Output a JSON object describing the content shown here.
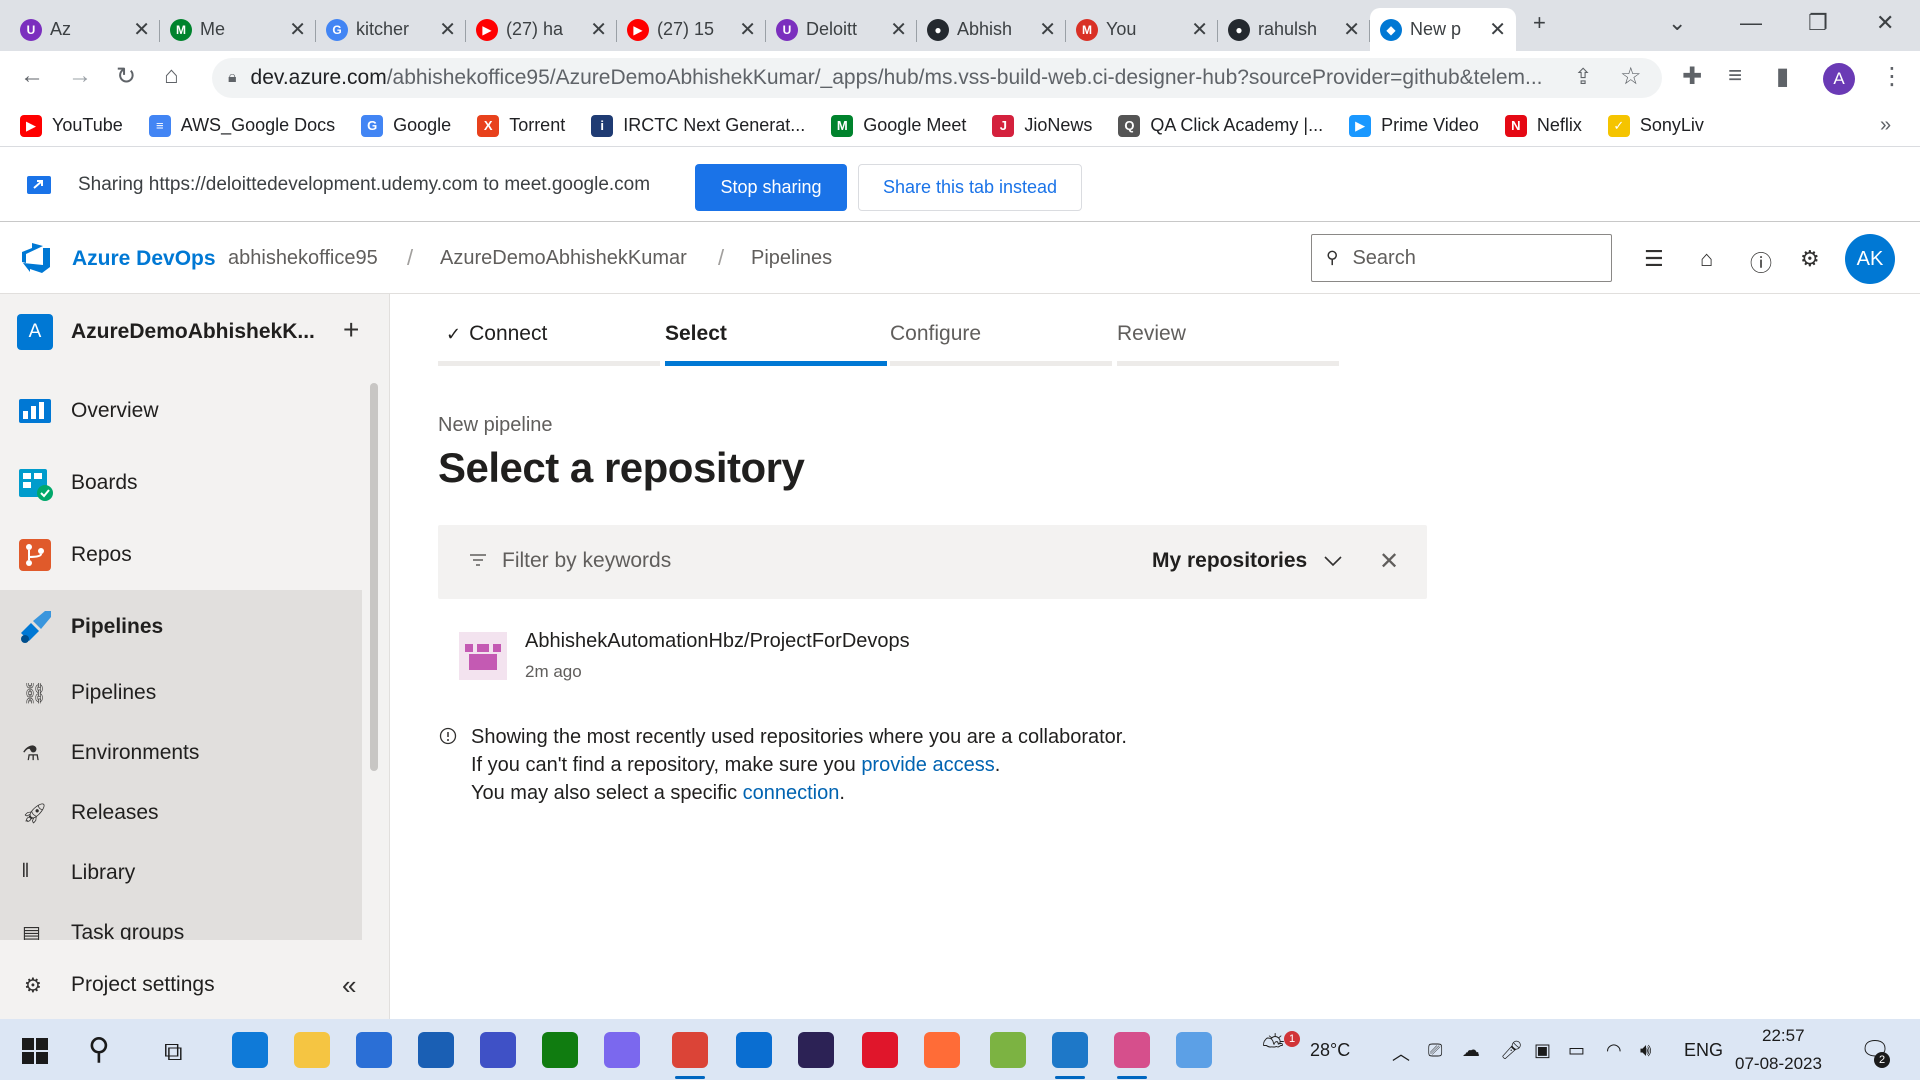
{
  "browser": {
    "tabs": [
      {
        "label": "Az",
        "color": "#7b2fbe",
        "glyph": "U"
      },
      {
        "label": "Me",
        "color": "#00832d",
        "glyph": "M"
      },
      {
        "label": "kitcher",
        "color": "#4285f4",
        "glyph": "G"
      },
      {
        "label": "(27) ha",
        "color": "#ff0000",
        "glyph": "▶"
      },
      {
        "label": "(27) 15",
        "color": "#ff0000",
        "glyph": "▶"
      },
      {
        "label": "Deloitt",
        "color": "#7b2fbe",
        "glyph": "U"
      },
      {
        "label": "Abhish",
        "color": "#24292f",
        "glyph": "●"
      },
      {
        "label": "You",
        "color": "#d93025",
        "glyph": "M"
      },
      {
        "label": "rahulsh",
        "color": "#24292f",
        "glyph": "●"
      },
      {
        "label": "New p",
        "color": "#0078d4",
        "glyph": "◆",
        "active": true
      }
    ],
    "url_domain": "dev.azure.com",
    "url_path": "/abhishekoffice95/AzureDemoAbhishekKumar/_apps/hub/ms.vss-build-web.ci-designer-hub?sourceProvider=github&telem...",
    "profile_initial": "A",
    "bookmarks": [
      {
        "label": "YouTube",
        "color": "#ff0000",
        "glyph": "▶"
      },
      {
        "label": "AWS_Google Docs",
        "color": "#4285f4",
        "glyph": "≡"
      },
      {
        "label": "Google",
        "color": "#4285f4",
        "glyph": "G"
      },
      {
        "label": "Torrent",
        "color": "#e8411c",
        "glyph": "X"
      },
      {
        "label": "IRCTC Next Generat...",
        "color": "#1f3b73",
        "glyph": "i"
      },
      {
        "label": "Google Meet",
        "color": "#00832d",
        "glyph": "M"
      },
      {
        "label": "JioNews",
        "color": "#d4213d",
        "glyph": "J"
      },
      {
        "label": "QA Click Academy |...",
        "color": "#555555",
        "glyph": "Q"
      },
      {
        "label": "Prime Video",
        "color": "#1a98ff",
        "glyph": "▶"
      },
      {
        "label": "Neflix",
        "color": "#e50914",
        "glyph": "N"
      },
      {
        "label": "SonyLiv",
        "color": "#f5c400",
        "glyph": "✓"
      }
    ]
  },
  "sharebar": {
    "text": "Sharing https://deloittedevelopment.udemy.com to meet.google.com",
    "stop_label": "Stop sharing",
    "share_tab_label": "Share this tab instead"
  },
  "azure": {
    "brand": "Azure DevOps",
    "breadcrumb": [
      "abhishekoffice95",
      "AzureDemoAbhishekKumar",
      "Pipelines"
    ],
    "search_placeholder": "Search",
    "avatar_initials": "AK"
  },
  "sidebar": {
    "project_initial": "A",
    "project_name": "AzureDemoAbhishekK...",
    "items": [
      {
        "label": "Overview"
      },
      {
        "label": "Boards"
      },
      {
        "label": "Repos"
      },
      {
        "label": "Pipelines"
      }
    ],
    "sub_items": [
      {
        "label": "Pipelines"
      },
      {
        "label": "Environments"
      },
      {
        "label": "Releases"
      },
      {
        "label": "Library"
      },
      {
        "label": "Task groups"
      }
    ],
    "settings_label": "Project settings"
  },
  "wizard": {
    "steps": [
      "Connect",
      "Select",
      "Configure",
      "Review"
    ],
    "active_step": "Select",
    "subtitle": "New pipeline",
    "title": "Select a repository",
    "filter_placeholder": "Filter by keywords",
    "repo_filter": "My repositories",
    "repos": [
      {
        "name": "AbhishekAutomationHbz/ProjectForDevops",
        "time": "2m ago"
      }
    ],
    "info_line1": "Showing the most recently used repositories where you are a collaborator.",
    "info_line2_prefix": "If you can't find a repository, make sure you ",
    "info_line2_link": "provide access",
    "info_line2_suffix": ".",
    "info_line3_prefix": "You may also select a specific ",
    "info_line3_link": "connection",
    "info_line3_suffix": "."
  },
  "taskbar": {
    "weather": "28°C",
    "weather_badge": "1",
    "language": "ENG",
    "time": "22:57",
    "date": "07-08-2023",
    "notification_count": "2"
  }
}
